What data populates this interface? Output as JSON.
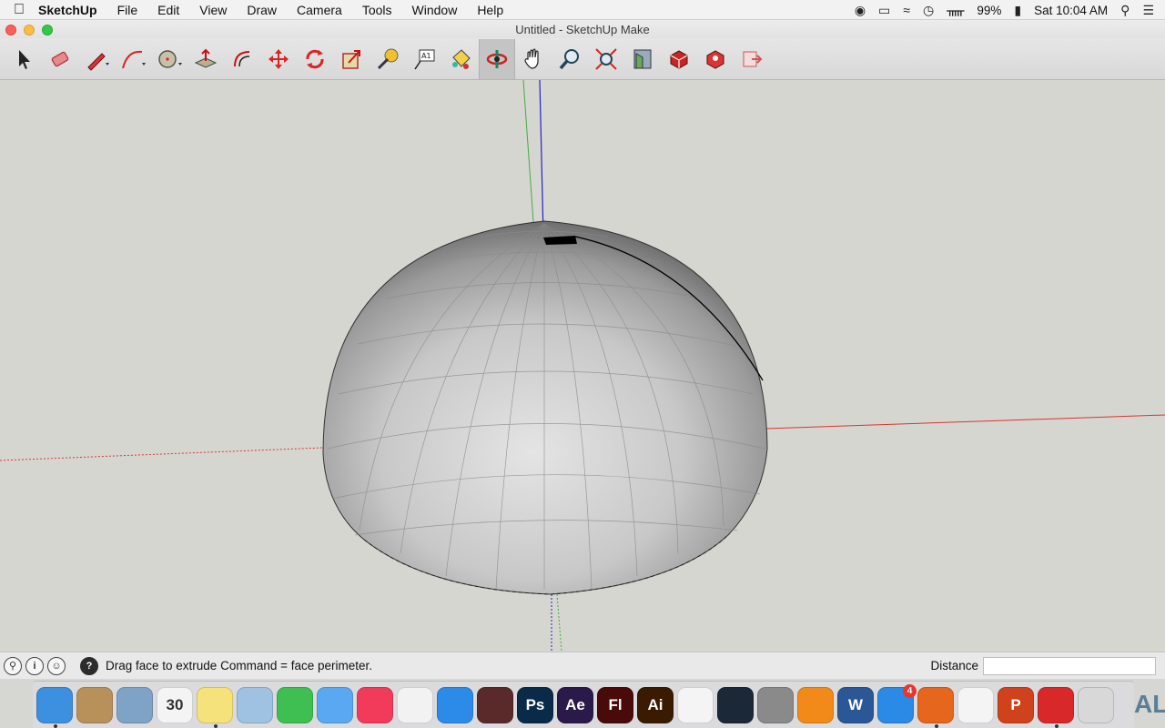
{
  "menubar": {
    "app_name": "SketchUp",
    "items": [
      "File",
      "Edit",
      "View",
      "Draw",
      "Camera",
      "Tools",
      "Window",
      "Help"
    ],
    "battery": "99%",
    "clock": "Sat 10:04 AM"
  },
  "window": {
    "title": "Untitled - SketchUp Make"
  },
  "toolbar": {
    "tools": [
      {
        "name": "select-tool",
        "icon": "arrow-icon"
      },
      {
        "name": "eraser-tool",
        "icon": "eraser-icon"
      },
      {
        "name": "line-tool",
        "icon": "pencil-icon"
      },
      {
        "name": "arc-tool",
        "icon": "arc-icon"
      },
      {
        "name": "shape-tool",
        "icon": "circle-icon"
      },
      {
        "name": "push-pull-tool",
        "icon": "push-pull-icon"
      },
      {
        "name": "offset-tool",
        "icon": "offset-icon"
      },
      {
        "name": "move-tool",
        "icon": "move-icon"
      },
      {
        "name": "rotate-tool",
        "icon": "rotate-icon"
      },
      {
        "name": "scale-tool",
        "icon": "scale-icon"
      },
      {
        "name": "tape-measure-tool",
        "icon": "tape-measure-icon"
      },
      {
        "name": "text-tool",
        "icon": "text-icon"
      },
      {
        "name": "paint-bucket-tool",
        "icon": "paint-bucket-icon"
      },
      {
        "name": "orbit-tool",
        "icon": "orbit-icon",
        "active": true
      },
      {
        "name": "pan-tool",
        "icon": "hand-icon"
      },
      {
        "name": "zoom-tool",
        "icon": "magnifier-icon"
      },
      {
        "name": "zoom-extents-tool",
        "icon": "zoom-extents-icon"
      },
      {
        "name": "warehouse-tool",
        "icon": "warehouse-icon"
      },
      {
        "name": "extension-warehouse-tool",
        "icon": "extension-icon"
      },
      {
        "name": "extension-manager-tool",
        "icon": "extension-manager-icon"
      },
      {
        "name": "share-model-tool",
        "icon": "share-icon"
      }
    ]
  },
  "statusbar": {
    "message": "Drag face to extrude  Command = face perimeter.",
    "measurement_label": "Distance",
    "measurement_value": "",
    "help_icon": "?"
  },
  "dock": {
    "apps": [
      {
        "name": "Finder",
        "label": "",
        "color": "#3d8fe0",
        "running": true
      },
      {
        "name": "Contacts",
        "label": "",
        "color": "#b8905a"
      },
      {
        "name": "Mail",
        "label": "",
        "color": "#7fa3c6"
      },
      {
        "name": "Calendar",
        "label": "30",
        "color": "#f4f4f4"
      },
      {
        "name": "Notes",
        "label": "",
        "color": "#f6e27a",
        "running": true
      },
      {
        "name": "Preview",
        "label": "",
        "color": "#9fc1e2"
      },
      {
        "name": "FaceTime",
        "label": "",
        "color": "#3fbf52"
      },
      {
        "name": "Messages",
        "label": "",
        "color": "#5aa8f2"
      },
      {
        "name": "iTunes",
        "label": "",
        "color": "#f23b5a"
      },
      {
        "name": "Reminders",
        "label": "",
        "color": "#f2f2f2"
      },
      {
        "name": "Safari",
        "label": "",
        "color": "#2b8be6"
      },
      {
        "name": "Photo Booth",
        "label": "",
        "color": "#5a2a2a"
      },
      {
        "name": "Photoshop",
        "label": "Ps",
        "color": "#0a2a4a"
      },
      {
        "name": "After Effects",
        "label": "Ae",
        "color": "#2a1a4a"
      },
      {
        "name": "Flash",
        "label": "Fl",
        "color": "#4a0a0a"
      },
      {
        "name": "Illustrator",
        "label": "Ai",
        "color": "#3a1a00"
      },
      {
        "name": "Photos",
        "label": "",
        "color": "#f4f4f4"
      },
      {
        "name": "Steam",
        "label": "",
        "color": "#1b2838"
      },
      {
        "name": "System Preferences",
        "label": "",
        "color": "#8a8a8a"
      },
      {
        "name": "iBooks",
        "label": "",
        "color": "#f28a1a"
      },
      {
        "name": "Word",
        "label": "W",
        "color": "#2b5797"
      },
      {
        "name": "App Store",
        "label": "",
        "color": "#2a8ae6",
        "badge": "4"
      },
      {
        "name": "Firefox",
        "label": "",
        "color": "#e5661c",
        "running": true
      },
      {
        "name": "Chrome",
        "label": "",
        "color": "#f4f4f4"
      },
      {
        "name": "PowerPoint",
        "label": "P",
        "color": "#d0421b"
      },
      {
        "name": "SketchUp",
        "label": "",
        "color": "#d8282a",
        "running": true
      },
      {
        "name": "Trash",
        "label": "",
        "color": "#d8d8d8"
      }
    ],
    "right_text": "AL"
  }
}
